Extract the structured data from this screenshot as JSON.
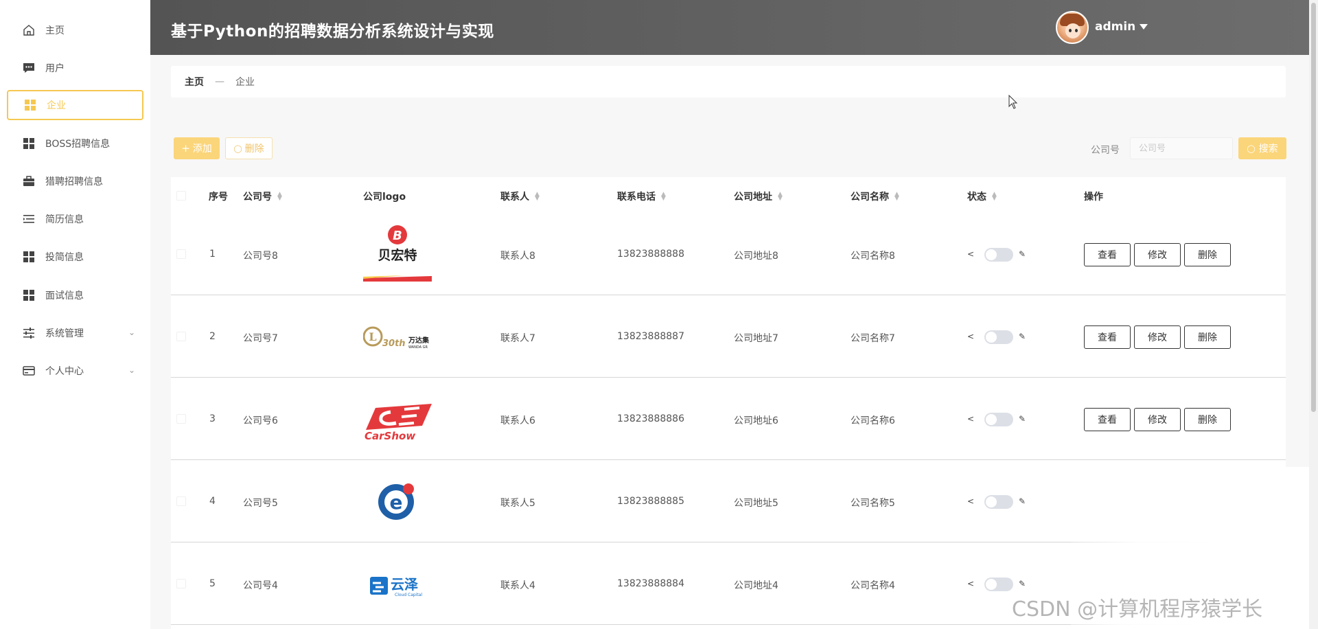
{
  "header": {
    "title": "基于Python的招聘数据分析系统设计与实现",
    "user_name": "admin"
  },
  "sidebar": {
    "items": [
      {
        "label": "主页",
        "icon": "home-icon"
      },
      {
        "label": "用户",
        "icon": "chat-icon"
      },
      {
        "label": "企业",
        "icon": "grid-icon",
        "active": true
      },
      {
        "label": "BOSS招聘信息",
        "icon": "grid-icon"
      },
      {
        "label": "猎聘招聘信息",
        "icon": "briefcase-icon"
      },
      {
        "label": "简历信息",
        "icon": "list-icon"
      },
      {
        "label": "投简信息",
        "icon": "grid-icon"
      },
      {
        "label": "面试信息",
        "icon": "grid-icon"
      },
      {
        "label": "系统管理",
        "icon": "sliders-icon",
        "expandable": true
      },
      {
        "label": "个人中心",
        "icon": "card-icon",
        "expandable": true
      }
    ]
  },
  "breadcrumb": {
    "home": "主页",
    "separator": "—",
    "current": "企业"
  },
  "toolbar": {
    "add_label": "添加",
    "delete_label": "删除",
    "search_label": "公司号",
    "search_placeholder": "公司号",
    "search_button": "搜索"
  },
  "table": {
    "headers": [
      "序号",
      "公司号",
      "公司logo",
      "联系人",
      "联系电话",
      "公司地址",
      "公司名称",
      "状态",
      "操作"
    ],
    "rows": [
      {
        "index": "1",
        "company_no": "公司号8",
        "logo": "贝宏特",
        "contact": "联系人8",
        "phone": "13823888888",
        "address": "公司地址8",
        "name": "公司名称8"
      },
      {
        "index": "2",
        "company_no": "公司号7",
        "logo": "万达集",
        "contact": "联系人7",
        "phone": "13823888887",
        "address": "公司地址7",
        "name": "公司名称7"
      },
      {
        "index": "3",
        "company_no": "公司号6",
        "logo": "CarShow",
        "contact": "联系人6",
        "phone": "13823888886",
        "address": "公司地址6",
        "name": "公司名称6"
      },
      {
        "index": "4",
        "company_no": "公司号5",
        "logo": "e",
        "contact": "联系人5",
        "phone": "13823888885",
        "address": "公司地址5",
        "name": "公司名称5"
      },
      {
        "index": "5",
        "company_no": "公司号4",
        "logo": "云泽",
        "contact": "联系人4",
        "phone": "13823888884",
        "address": "公司地址4",
        "name": "公司名称4"
      }
    ],
    "actions": {
      "view": "查看",
      "edit": "修改",
      "delete": "删除"
    }
  },
  "logo_text": {
    "wanda_sub": "30th",
    "wanda_en": "WANDA GR",
    "yunze_en": "Cloud Capital"
  },
  "watermark": "CSDN @计算机程序猿学长",
  "colors": {
    "accent": "#f5c850",
    "header_bg": "#5a5a5a",
    "logo_red": "#e4393c"
  }
}
